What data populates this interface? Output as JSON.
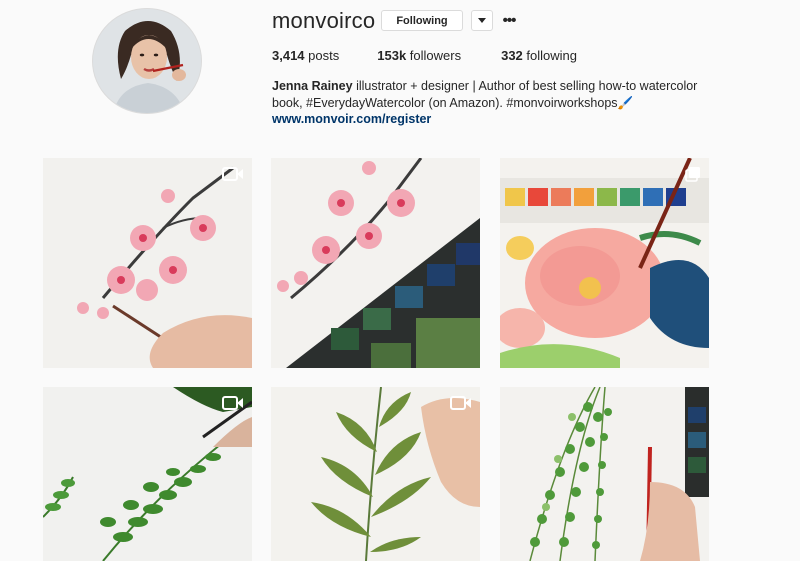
{
  "profile": {
    "username": "monvoirco",
    "follow_label": "Following",
    "more_label": "•••",
    "stats": {
      "posts_count": "3,414",
      "posts_label": "posts",
      "followers_count": "153k",
      "followers_label": "followers",
      "following_count": "332",
      "following_label": "following"
    },
    "bio": {
      "full_name": "Jenna Rainey",
      "text": " illustrator + designer | Author of best selling how-to watercolor book, #EverydayWatercolor (on Amazon). #monvoirworkshops🖌️",
      "link": "www.monvoir.com/register"
    }
  },
  "posts": [
    {
      "subject": "cherry blossom branch painting",
      "media": "video-icon"
    },
    {
      "subject": "cherry blossom with watercolor palette",
      "media": "none"
    },
    {
      "subject": "pink watercolor florals with palette",
      "media": "gallery-icon"
    },
    {
      "subject": "fern leaves painting",
      "media": "video-icon"
    },
    {
      "subject": "green leafy stem painting",
      "media": "video-icon"
    },
    {
      "subject": "hanging vine leaves with palette",
      "media": "none"
    }
  ],
  "colors": {
    "background": "#fafafa",
    "text": "#262626",
    "link": "#003569",
    "border": "#dbdbdb"
  }
}
